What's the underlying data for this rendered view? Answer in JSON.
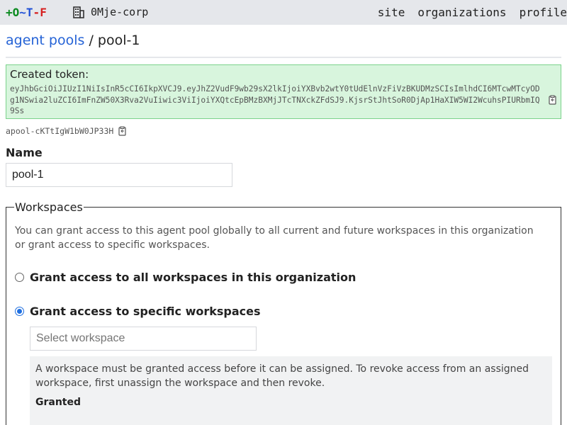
{
  "topbar": {
    "logo": {
      "plus": "+",
      "o": "O",
      "t1": "~T",
      "dash": "-",
      "f": "F"
    },
    "org_name": "0Mje-corp",
    "org_icon": "building-icon",
    "nav": [
      "site",
      "organizations",
      "profile"
    ]
  },
  "breadcrumb": {
    "parent": "agent pools",
    "separator": " / ",
    "current": "pool-1"
  },
  "token": {
    "title": "Created token:",
    "value": "eyJhbGciOiJIUzI1NiIsInR5cCI6IkpXVCJ9.eyJhZ2VudF9wb29sX2lkIjoiYXBvb2wtY0tUdElnVzFiVzBKUDMzSCIsImlhdCI6MTcwMTcyODg1NSwia2luZCI6ImFnZW50X3Rva2VuIiwic3ViIjoiYXQtcEpBMzBXMjJTcTNXckZFdSJ9.KjsrStJhtSoR0DjAp1HaXIW5WI2WcuhsPIURbmIQ9Ss",
    "copy_icon": "clipboard-icon"
  },
  "pool": {
    "id": "apool-cKTtIgW1bW0JP33H",
    "copy_icon": "clipboard-icon"
  },
  "form": {
    "name_label": "Name",
    "name_value": "pool-1"
  },
  "workspaces": {
    "legend": "Workspaces",
    "description": "You can grant access to this agent pool globally to all current and future workspaces in this organization or grant access to specific workspaces.",
    "option_all": "Grant access to all workspaces in this organization",
    "option_specific": "Grant access to specific workspaces",
    "selected": "specific",
    "select_placeholder": "Select workspace",
    "note": "A workspace must be granted access before it can be assigned. To revoke access from an assigned workspace, first unassign the workspace and then revoke.",
    "granted_heading": "Granted"
  },
  "colors": {
    "link": "#2563d6",
    "token_bg": "#d8f5dd",
    "token_border": "#7bd38b",
    "radio_accent": "#1f6fe0",
    "topbar_bg": "#e5e7eb"
  }
}
